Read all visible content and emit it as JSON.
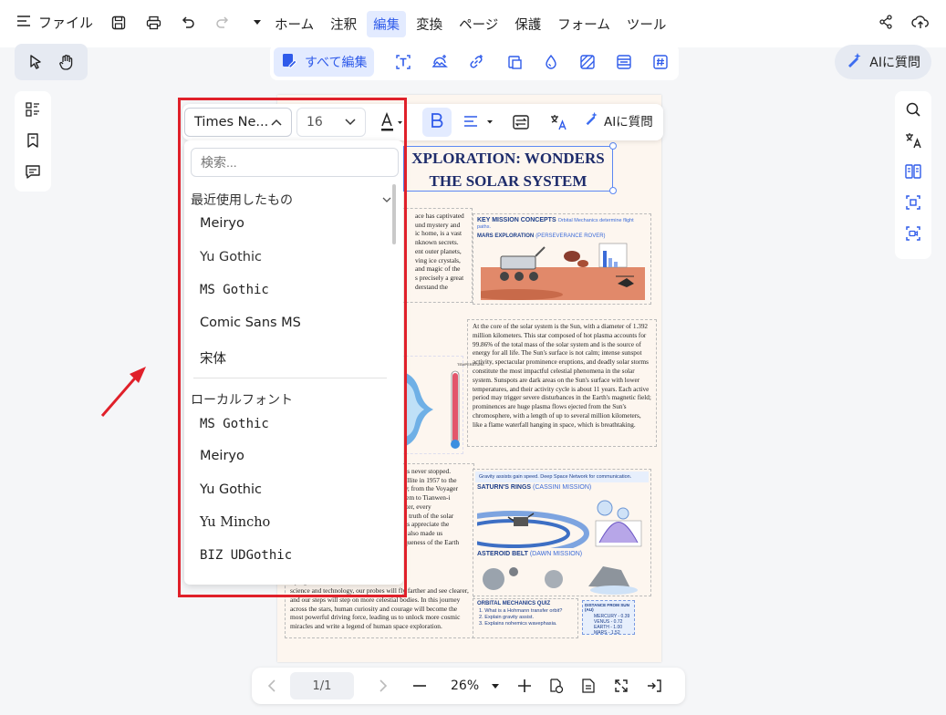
{
  "topbar": {
    "file_label": "ファイル",
    "tabs": [
      {
        "label": "ホーム",
        "active": false
      },
      {
        "label": "注釈",
        "active": false
      },
      {
        "label": "編集",
        "active": true
      },
      {
        "label": "変換",
        "active": false
      },
      {
        "label": "ページ",
        "active": false
      },
      {
        "label": "保護",
        "active": false
      },
      {
        "label": "フォーム",
        "active": false
      },
      {
        "label": "ツール",
        "active": false
      }
    ]
  },
  "edit_toolbar": {
    "edit_all_label": "すべて編集",
    "ai_button_label": "AIに質問"
  },
  "font_toolbar": {
    "font_name": "Times Ne...",
    "font_size": "16",
    "ai_label": "AIに質問"
  },
  "font_dropdown": {
    "search_placeholder": "検索...",
    "recent_heading": "最近使用したもの",
    "recent_fonts": [
      "Meiryo",
      "Yu Gothic",
      "MS Gothic",
      "Comic Sans MS",
      "宋体"
    ],
    "local_heading": "ローカルフォント",
    "local_fonts": [
      "MS Gothic",
      "Meiryo",
      "Yu Gothic",
      "Yu Mincho",
      "BIZ UDGothic"
    ]
  },
  "document": {
    "title_line1": "XPLORATION: WONDERS",
    "title_line2": "THE SOLAR SYSTEM",
    "intro_text": "ace has captivated\nund mystery and\nic home, is a vast\nnknown secrets.\nent outer planets,\nving ice crystals,\nand magic of the\ns precisely a great\nderstand the",
    "key_concepts_heading": "KEY MISSION CONCEPTS",
    "key_concepts_sub": "Orbital Mechanics determine flight paths.",
    "mars_heading": "MARS EXPLORATION",
    "mars_sub": "(PERSEVERANCE ROVER)",
    "sun_text": "At the core of the solar system is the Sun, with a diameter of 1.392 million kilometers. This star composed of hot plasma accounts for 99.86% of the total mass of the solar system and is the source of energy for all life. The Sun's surface is not calm; intense sunspot activity, spectacular prominence eruptions, and deadly solar storms constitute the most impactful celestial phenomena in the solar system. Sunspots are dark areas on the Sun's surface with lower temperatures, and their activity cycle is about 11 years. Each active period may trigger severe disturbances in the Earth's magnetic field; prominences are huge plasma flows ejected from the Sun's chromosphere, with a length of up to several million kilometers, like a flame waterfall hanging in space, which is breathtaking.",
    "voyage_text": "as never stopped.\nellite in 1957 to the\n9; from the Voyager\ntem to Tianwen-i\niter, every\ne truth of the solar\nas appreciate the\nt also made us\nqueness of the Earth",
    "future_text": "more than these,\nwaiting for\ns progress of\nscience and technology, our probes will fly farther and see clearer, and our steps will step on more celestial bodies. In this journey across the stars, human curiosity and courage will become the most powerful driving force, leading us to unlock more cosmic miracles and write a legend of human space exploration.",
    "gravity_note": "Gravity assists gain speed. Deep Space Network for communication.",
    "saturn_heading": "SATURN'S RINGS",
    "saturn_sub": "(CASSINI MISSION)",
    "asteroid_heading": "ASTEROID BELT",
    "asteroid_sub": "(DAWN MISSION)",
    "quiz_heading": "ORBITAL MECHANICS QUIZ",
    "quiz_items": [
      "1. What is a Hohmann transfer orbit?",
      "2. Explain gravity assist.",
      "3. Explains nohemics wavephasia."
    ],
    "distance_heading": "DISTANCE FROM SUN (AU)",
    "distance_rows": [
      "MERCURY - 0.39",
      "VENUS - 0.72",
      "EARTH - 1.00",
      "MARS - 1.52"
    ],
    "temp_label": "TEMPERATURE"
  },
  "bottom_bar": {
    "page_indicator": "1/1",
    "zoom": "26%"
  },
  "colors": {
    "accent": "#2f5bea",
    "highlight": "#e0202a",
    "doc_background": "#fdf6ef"
  }
}
